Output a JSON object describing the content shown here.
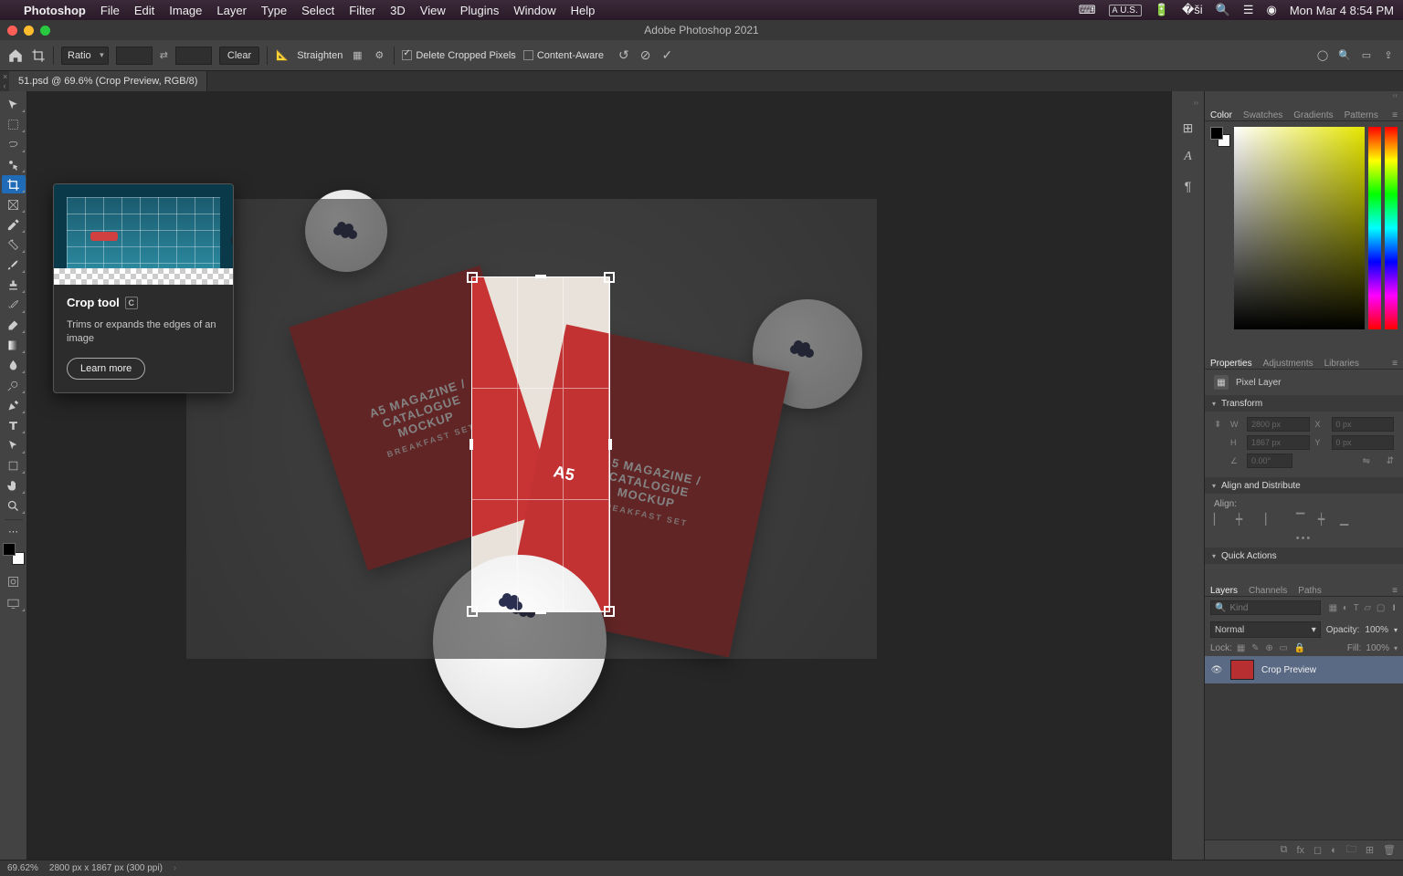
{
  "menubar": {
    "app": "Photoshop",
    "items": [
      "File",
      "Edit",
      "Image",
      "Layer",
      "Type",
      "Select",
      "Filter",
      "3D",
      "View",
      "Plugins",
      "Window",
      "Help"
    ],
    "input_lang": "U.S.",
    "clock": "Mon Mar 4  8:54 PM"
  },
  "window": {
    "title": "Adobe Photoshop 2021"
  },
  "options": {
    "preset": "Ratio",
    "clear": "Clear",
    "straighten": "Straighten",
    "delete_cropped": "Delete Cropped Pixels",
    "content_aware": "Content-Aware"
  },
  "doc_tab": {
    "name": "51.psd @ 69.6% (Crop Preview, RGB/8)"
  },
  "tooltip": {
    "title": "Crop tool",
    "shortcut": "C",
    "desc": "Trims or expands the edges of an image",
    "learn": "Learn more"
  },
  "mockup": {
    "line1": "A5 MAGAZINE /",
    "line2": "CATALOGUE",
    "line3": "MOCKUP",
    "sub": "BREAKFAST SET",
    "crop_label": "A5"
  },
  "panels": {
    "color_tabs": [
      "Color",
      "Swatches",
      "Gradients",
      "Patterns"
    ],
    "props_tabs": [
      "Properties",
      "Adjustments",
      "Libraries"
    ],
    "pixel_layer": "Pixel Layer",
    "transform": "Transform",
    "transform_vals": {
      "w": "2800 px",
      "h": "1867 px",
      "x": "0 px",
      "y": "0 px",
      "angle": "0.00°"
    },
    "align": "Align and Distribute",
    "align_label": "Align:",
    "quick": "Quick Actions",
    "layers_tabs": [
      "Layers",
      "Channels",
      "Paths"
    ],
    "kind": "Kind",
    "blend": "Normal",
    "opacity_label": "Opacity:",
    "opacity": "100%",
    "lock": "Lock:",
    "fill_label": "Fill:",
    "fill": "100%",
    "layer_name": "Crop Preview"
  },
  "status": {
    "zoom": "69.62%",
    "dims": "2800 px x 1867 px (300 ppi)"
  }
}
